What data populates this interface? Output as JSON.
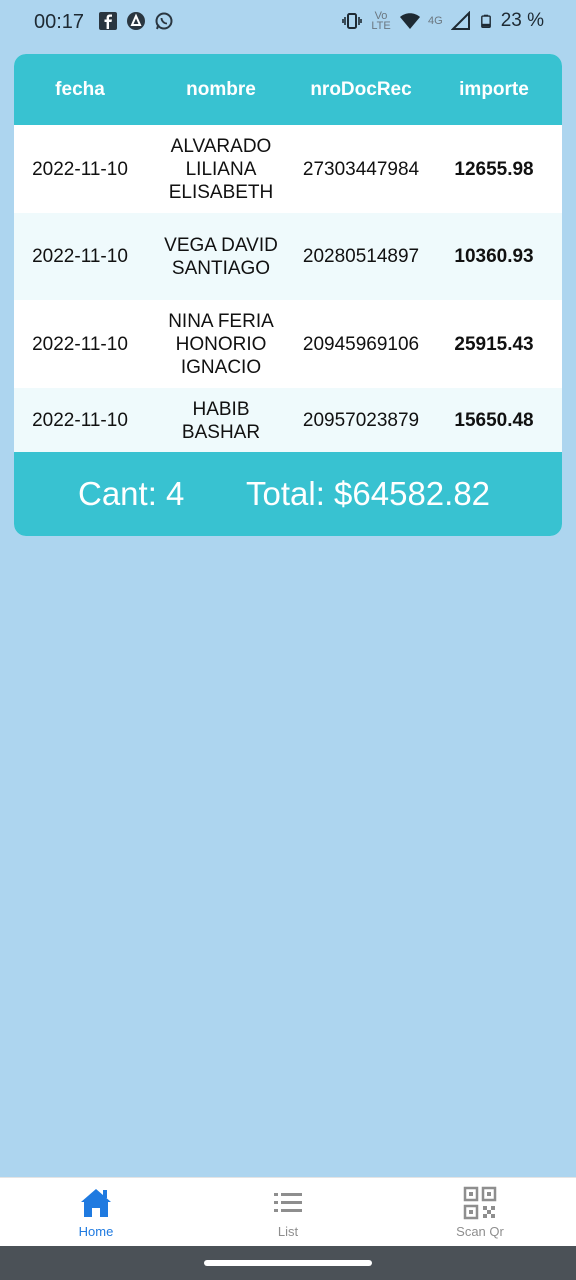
{
  "status_bar": {
    "time": "00:17",
    "battery_percent": "23 %",
    "network_label": "4G",
    "volte_label": "Vo LTE",
    "left_icons": [
      "facebook-icon",
      "app-icon",
      "whatsapp-icon"
    ],
    "right_icons": [
      "vibrate-icon",
      "volte-icon",
      "wifi-icon",
      "signal-icon",
      "battery-icon"
    ]
  },
  "table": {
    "headers": [
      "fecha",
      "nombre",
      "nroDocRec",
      "importe"
    ],
    "rows": [
      {
        "fecha": "2022-11-10",
        "nombre": "ALVARADO LILIANA ELISABETH",
        "nroDocRec": "27303447984",
        "importe": "12655.98"
      },
      {
        "fecha": "2022-11-10",
        "nombre": "VEGA DAVID SANTIAGO",
        "nroDocRec": "20280514897",
        "importe": "10360.93"
      },
      {
        "fecha": "2022-11-10",
        "nombre": "NINA FERIA HONORIO IGNACIO",
        "nroDocRec": "20945969106",
        "importe": "25915.43"
      },
      {
        "fecha": "2022-11-10",
        "nombre": "HABIB BASHAR",
        "nroDocRec": "20957023879",
        "importe": "15650.48"
      }
    ]
  },
  "summary": {
    "count_text": "Cant: 4",
    "total_text": "Total: $64582.82"
  },
  "bottom_nav": {
    "items": [
      {
        "label": "Home",
        "icon": "home-icon",
        "active": true
      },
      {
        "label": "List",
        "icon": "list-icon",
        "active": false
      },
      {
        "label": "Scan Qr",
        "icon": "qr-code-icon",
        "active": false
      }
    ]
  },
  "colors": {
    "background": "#add5ef",
    "accent": "#38c2d1",
    "active_nav": "#1f7ae0"
  }
}
